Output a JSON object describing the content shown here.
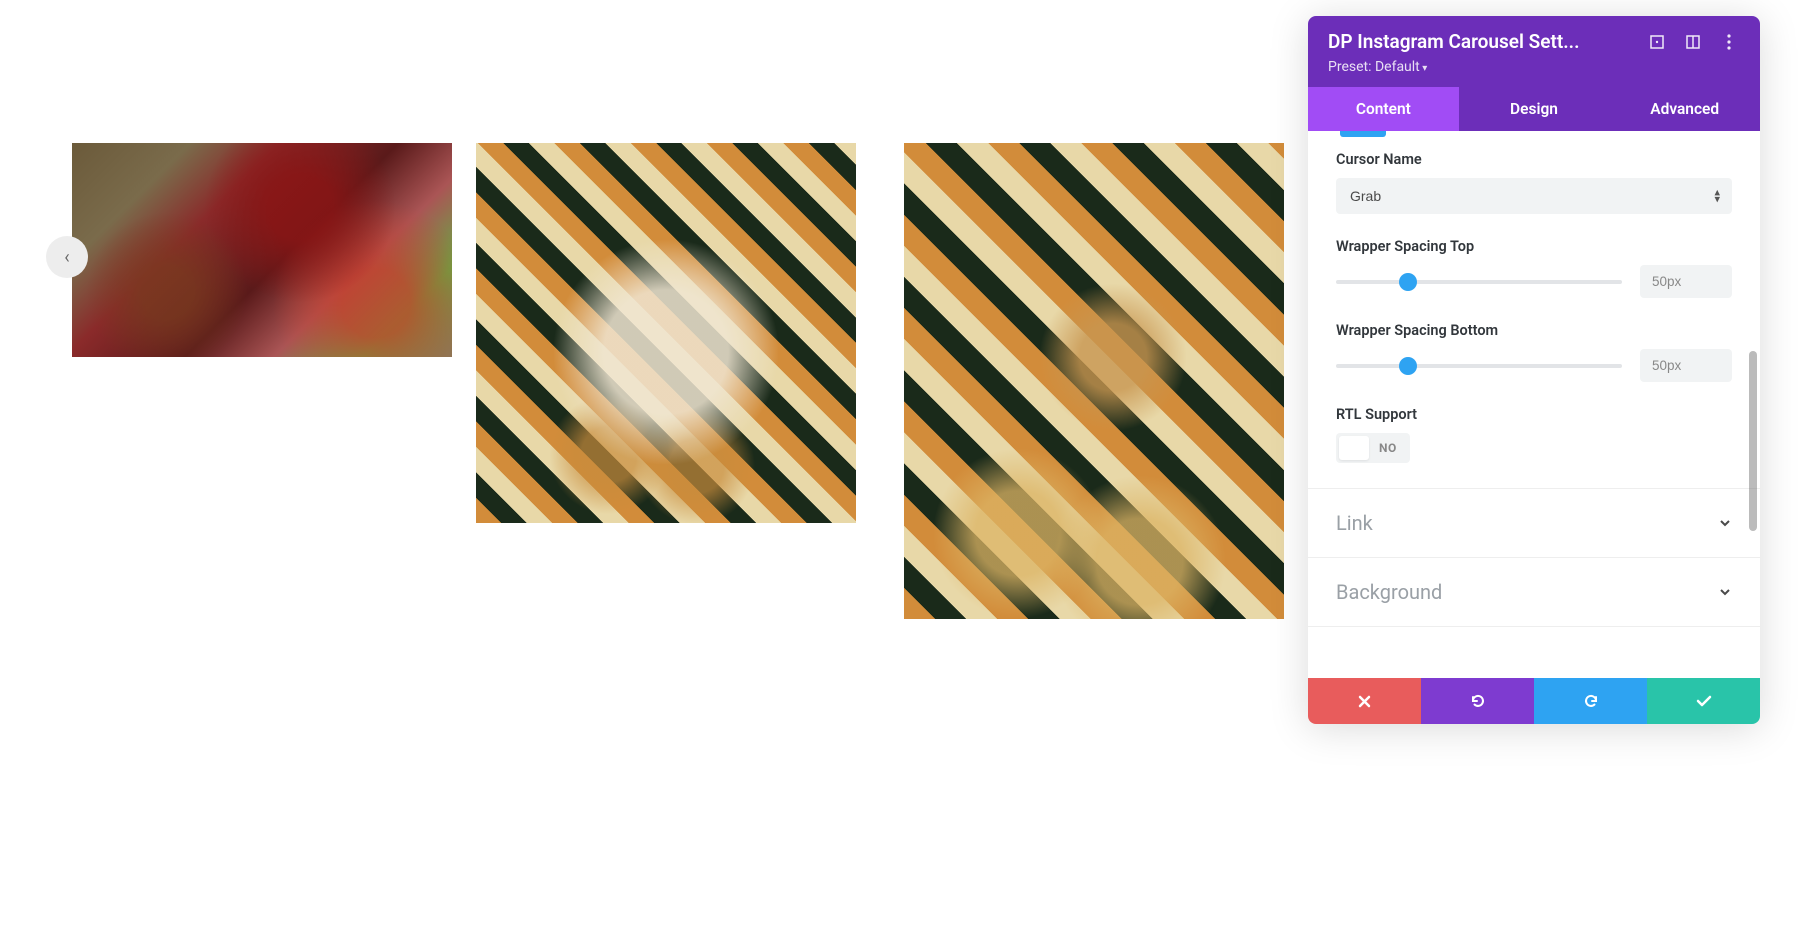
{
  "panel": {
    "title": "DP Instagram Carousel Sett...",
    "preset": "Preset: Default",
    "tabs": {
      "content": "Content",
      "design": "Design",
      "advanced": "Advanced"
    },
    "activeTab": "content"
  },
  "fields": {
    "cursor_name_label": "Cursor Name",
    "cursor_name_value": "Grab",
    "wrapper_top_label": "Wrapper Spacing Top",
    "wrapper_top_value": "50px",
    "wrapper_top_percent": 25,
    "wrapper_bottom_label": "Wrapper Spacing Bottom",
    "wrapper_bottom_value": "50px",
    "wrapper_bottom_percent": 25,
    "rtl_label": "RTL Support",
    "rtl_state": "NO"
  },
  "accordions": {
    "link": "Link",
    "background": "Background"
  },
  "carousel": {
    "prev_icon": "‹"
  }
}
